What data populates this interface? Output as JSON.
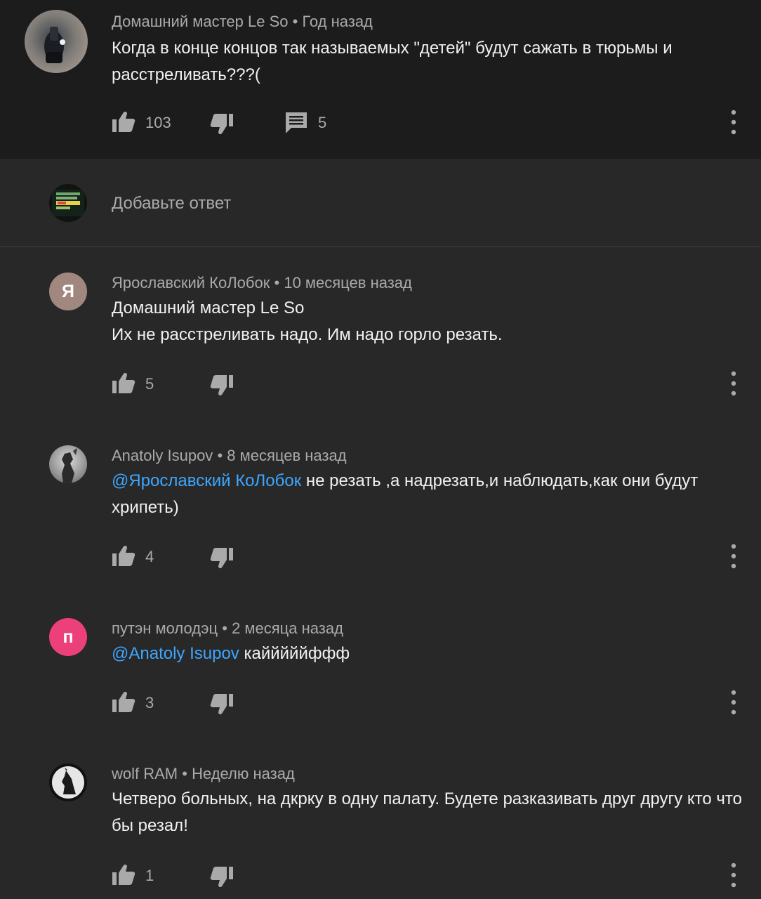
{
  "parent_comment": {
    "author": "Домашний мастер Le So",
    "time": "Год назад",
    "text": "Когда в конце концов так называемых \"детей\" будут сажать в тюрьмы и расстреливать???(",
    "likes": "103",
    "replies": "5"
  },
  "reply_box": {
    "placeholder": "Добавьте ответ"
  },
  "replies": [
    {
      "author": "Ярославский КоЛобок",
      "time": "10 месяцев назад",
      "avatar_letter": "Я",
      "avatar_color": "#a1887f",
      "mention": "",
      "line1": "Домашний мастер Le So",
      "line2": "Их не расстреливать надо. Им надо горло резать.",
      "likes": "5"
    },
    {
      "author": "Anatoly Isupov",
      "time": "8 месяцев назад",
      "mention": "@Ярославский КоЛобок",
      "text": " не резать ,а надрезать,и наблюдать,как они будут хрипеть)",
      "likes": "4"
    },
    {
      "author": "путэн молодэц",
      "time": "2 месяца назад",
      "avatar_letter": "п",
      "avatar_color": "#ec407a",
      "mention": "@Anatoly Isupov",
      "text": " кайййййффф",
      "likes": "3"
    },
    {
      "author": "wolf RAM",
      "time": "Неделю назад",
      "mention": "",
      "text": "Четверо больных, на дкрку в одну палату. Будете разказивать друг другу кто что бы резал!",
      "likes": "1"
    }
  ],
  "colors": {
    "background": "#282828",
    "parent_background": "#1c1c1c",
    "mention": "#3ea6ff",
    "meta_text": "#aaaaaa"
  },
  "icons": [
    "like-icon",
    "dislike-icon",
    "reply-icon",
    "more-vert-icon"
  ]
}
